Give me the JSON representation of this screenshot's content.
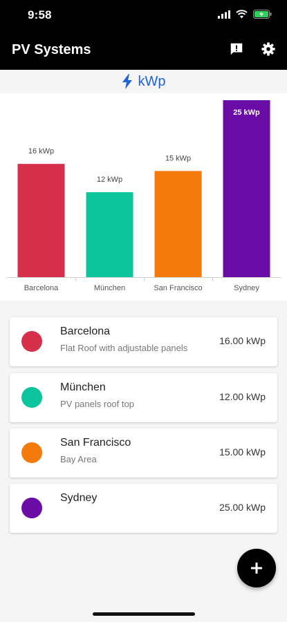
{
  "status": {
    "time": "9:58"
  },
  "app_bar": {
    "title": "PV Systems",
    "icons": [
      "feedback-icon",
      "settings-icon"
    ]
  },
  "unit_header": {
    "icon": "bolt-icon",
    "label": "kWp",
    "color": "#1e63d6"
  },
  "chart_data": {
    "type": "bar",
    "categories": [
      "Barcelona",
      "München",
      "San Francisco",
      "Sydney"
    ],
    "values": [
      16,
      12,
      15,
      25
    ],
    "data_labels": [
      "16 kWp",
      "12 kWp",
      "15 kWp",
      "25 kWp"
    ],
    "colors": [
      "#d62f4a",
      "#0dc59c",
      "#f57a0c",
      "#6a0da6"
    ],
    "title": "",
    "xlabel": "",
    "ylabel": "",
    "ylim": [
      0,
      25
    ],
    "grid": false
  },
  "systems": [
    {
      "name": "Barcelona",
      "description": "Flat Roof with adjustable panels",
      "value": "16.00 kWp",
      "color": "#d62f4a"
    },
    {
      "name": "München",
      "description": "PV panels roof top",
      "value": "12.00 kWp",
      "color": "#0dc59c"
    },
    {
      "name": "San Francisco",
      "description": "Bay Area",
      "value": "15.00 kWp",
      "color": "#f57a0c"
    },
    {
      "name": "Sydney",
      "description": "",
      "value": "25.00 kWp",
      "color": "#6a0da6"
    }
  ],
  "fab": {
    "icon": "plus-icon"
  }
}
